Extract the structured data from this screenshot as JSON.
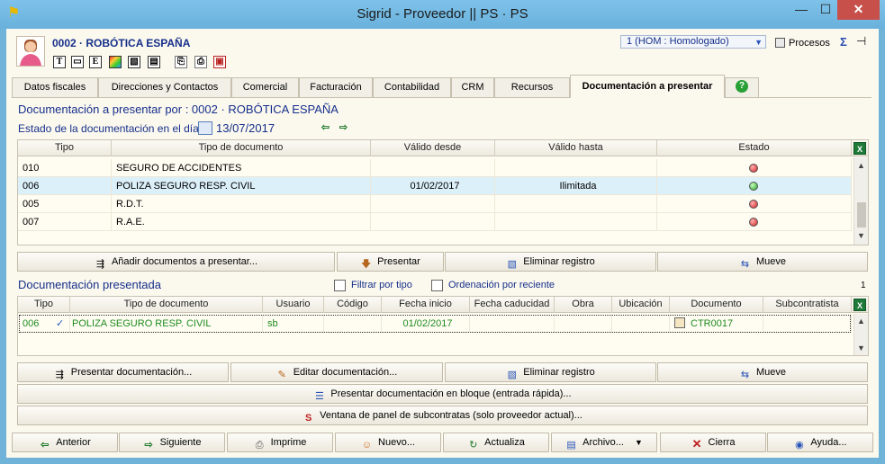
{
  "window": {
    "title": "Sigrid - Proveedor || PS · PS",
    "min": "—",
    "max": "☐",
    "close": "✕"
  },
  "header": {
    "company": "0002 · ROBÓTICA ESPAÑA",
    "toolbar_icons": [
      "T",
      "▭",
      "E",
      "▦",
      "▧",
      "▤",
      "⎘",
      "⎙",
      "▣"
    ],
    "status_select": "1 (HOM : Homologado)",
    "procesos": "Procesos",
    "sigma": "Σ",
    "pin": "⊣"
  },
  "tabs": [
    "Datos fiscales",
    "Direcciones y Contactos",
    "Comercial",
    "Facturación",
    "Contabilidad",
    "CRM",
    "Recursos",
    "Documentación a presentar"
  ],
  "help": "?",
  "section1": {
    "title": "Documentación a presentar por : 0002 · ROBÓTICA ESPAÑA",
    "estado_label": "Estado de la documentación en el día",
    "date": "13/07/2017",
    "columns": [
      "Tipo",
      "Tipo de documento",
      "Válido desde",
      "Válido hasta",
      "Estado"
    ],
    "rows": [
      {
        "tipo": "010",
        "doc": "SEGURO DE ACCIDENTES",
        "desde": "",
        "hasta": "",
        "estado": "red"
      },
      {
        "tipo": "006",
        "doc": "POLIZA SEGURO RESP. CIVIL",
        "desde": "01/02/2017",
        "hasta": "Ilimitada",
        "estado": "green"
      },
      {
        "tipo": "005",
        "doc": "R.D.T.",
        "desde": "",
        "hasta": "",
        "estado": "red"
      },
      {
        "tipo": "007",
        "doc": "R.A.E.",
        "desde": "",
        "hasta": "",
        "estado": "red"
      }
    ],
    "buttons": {
      "add": "Añadir documentos a presentar...",
      "present": "Presentar",
      "delete": "Eliminar registro",
      "move": "Mueve"
    }
  },
  "section2": {
    "title": "Documentación presentada",
    "filter_label": "Filtrar por tipo",
    "order_label": "Ordenación por reciente",
    "count": "1",
    "columns": [
      "Tipo",
      "Tipo de documento",
      "Usuario",
      "Código",
      "Fecha inicio",
      "Fecha caducidad",
      "Obra",
      "Ubicación",
      "Documento",
      "Subcontratista"
    ],
    "rows": [
      {
        "tipo": "006",
        "check": "✓",
        "doc": "POLIZA SEGURO RESP. CIVIL",
        "usuario": "sb",
        "codigo": "",
        "inicio": "01/02/2017",
        "caducidad": "",
        "obra": "",
        "ubicacion": "",
        "documento": "CTR0017",
        "subcontratista": ""
      }
    ],
    "buttons": {
      "present": "Presentar documentación...",
      "edit": "Editar documentación...",
      "delete": "Eliminar registro",
      "move": "Mueve",
      "bulk": "Presentar documentación en bloque (entrada rápida)...",
      "panel": "Ventana de panel de subcontratas (solo proveedor actual)..."
    }
  },
  "footer": {
    "prev": "Anterior",
    "next": "Siguiente",
    "print": "Imprime",
    "new": "Nuevo...",
    "refresh": "Actualiza",
    "archive": "Archivo...",
    "close": "Cierra",
    "help": "Ayuda..."
  },
  "colors": {
    "accent": "#16308a",
    "selected_row": "#dcf0fa",
    "presented_green": "#1e8a1e",
    "titlebar": "#6fb3d9"
  }
}
